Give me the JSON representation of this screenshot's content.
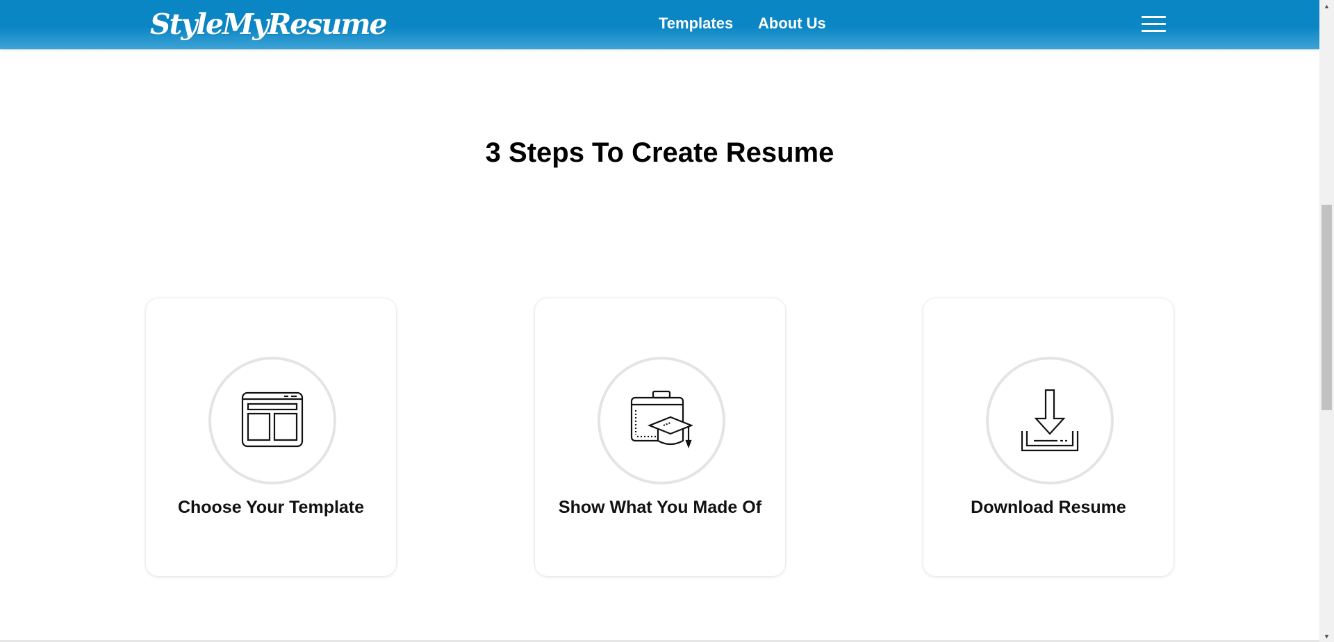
{
  "header": {
    "logo_text": "StyleMyResume",
    "nav": [
      {
        "label": "Templates"
      },
      {
        "label": "About Us"
      }
    ],
    "menu_icon": "hamburger-menu-icon"
  },
  "section": {
    "title": "3 Steps To Create Resume",
    "steps": [
      {
        "label": "Choose Your Template",
        "icon": "template-layout-icon"
      },
      {
        "label": "Show What You Made Of",
        "icon": "briefcase-graduation-cap-icon"
      },
      {
        "label": "Download Resume",
        "icon": "download-tray-icon"
      }
    ]
  },
  "colors": {
    "header_blue": "#0a86c4",
    "header_blue_light": "#3ea3d6",
    "text": "#111111",
    "circle_border": "#e4e4e7"
  }
}
